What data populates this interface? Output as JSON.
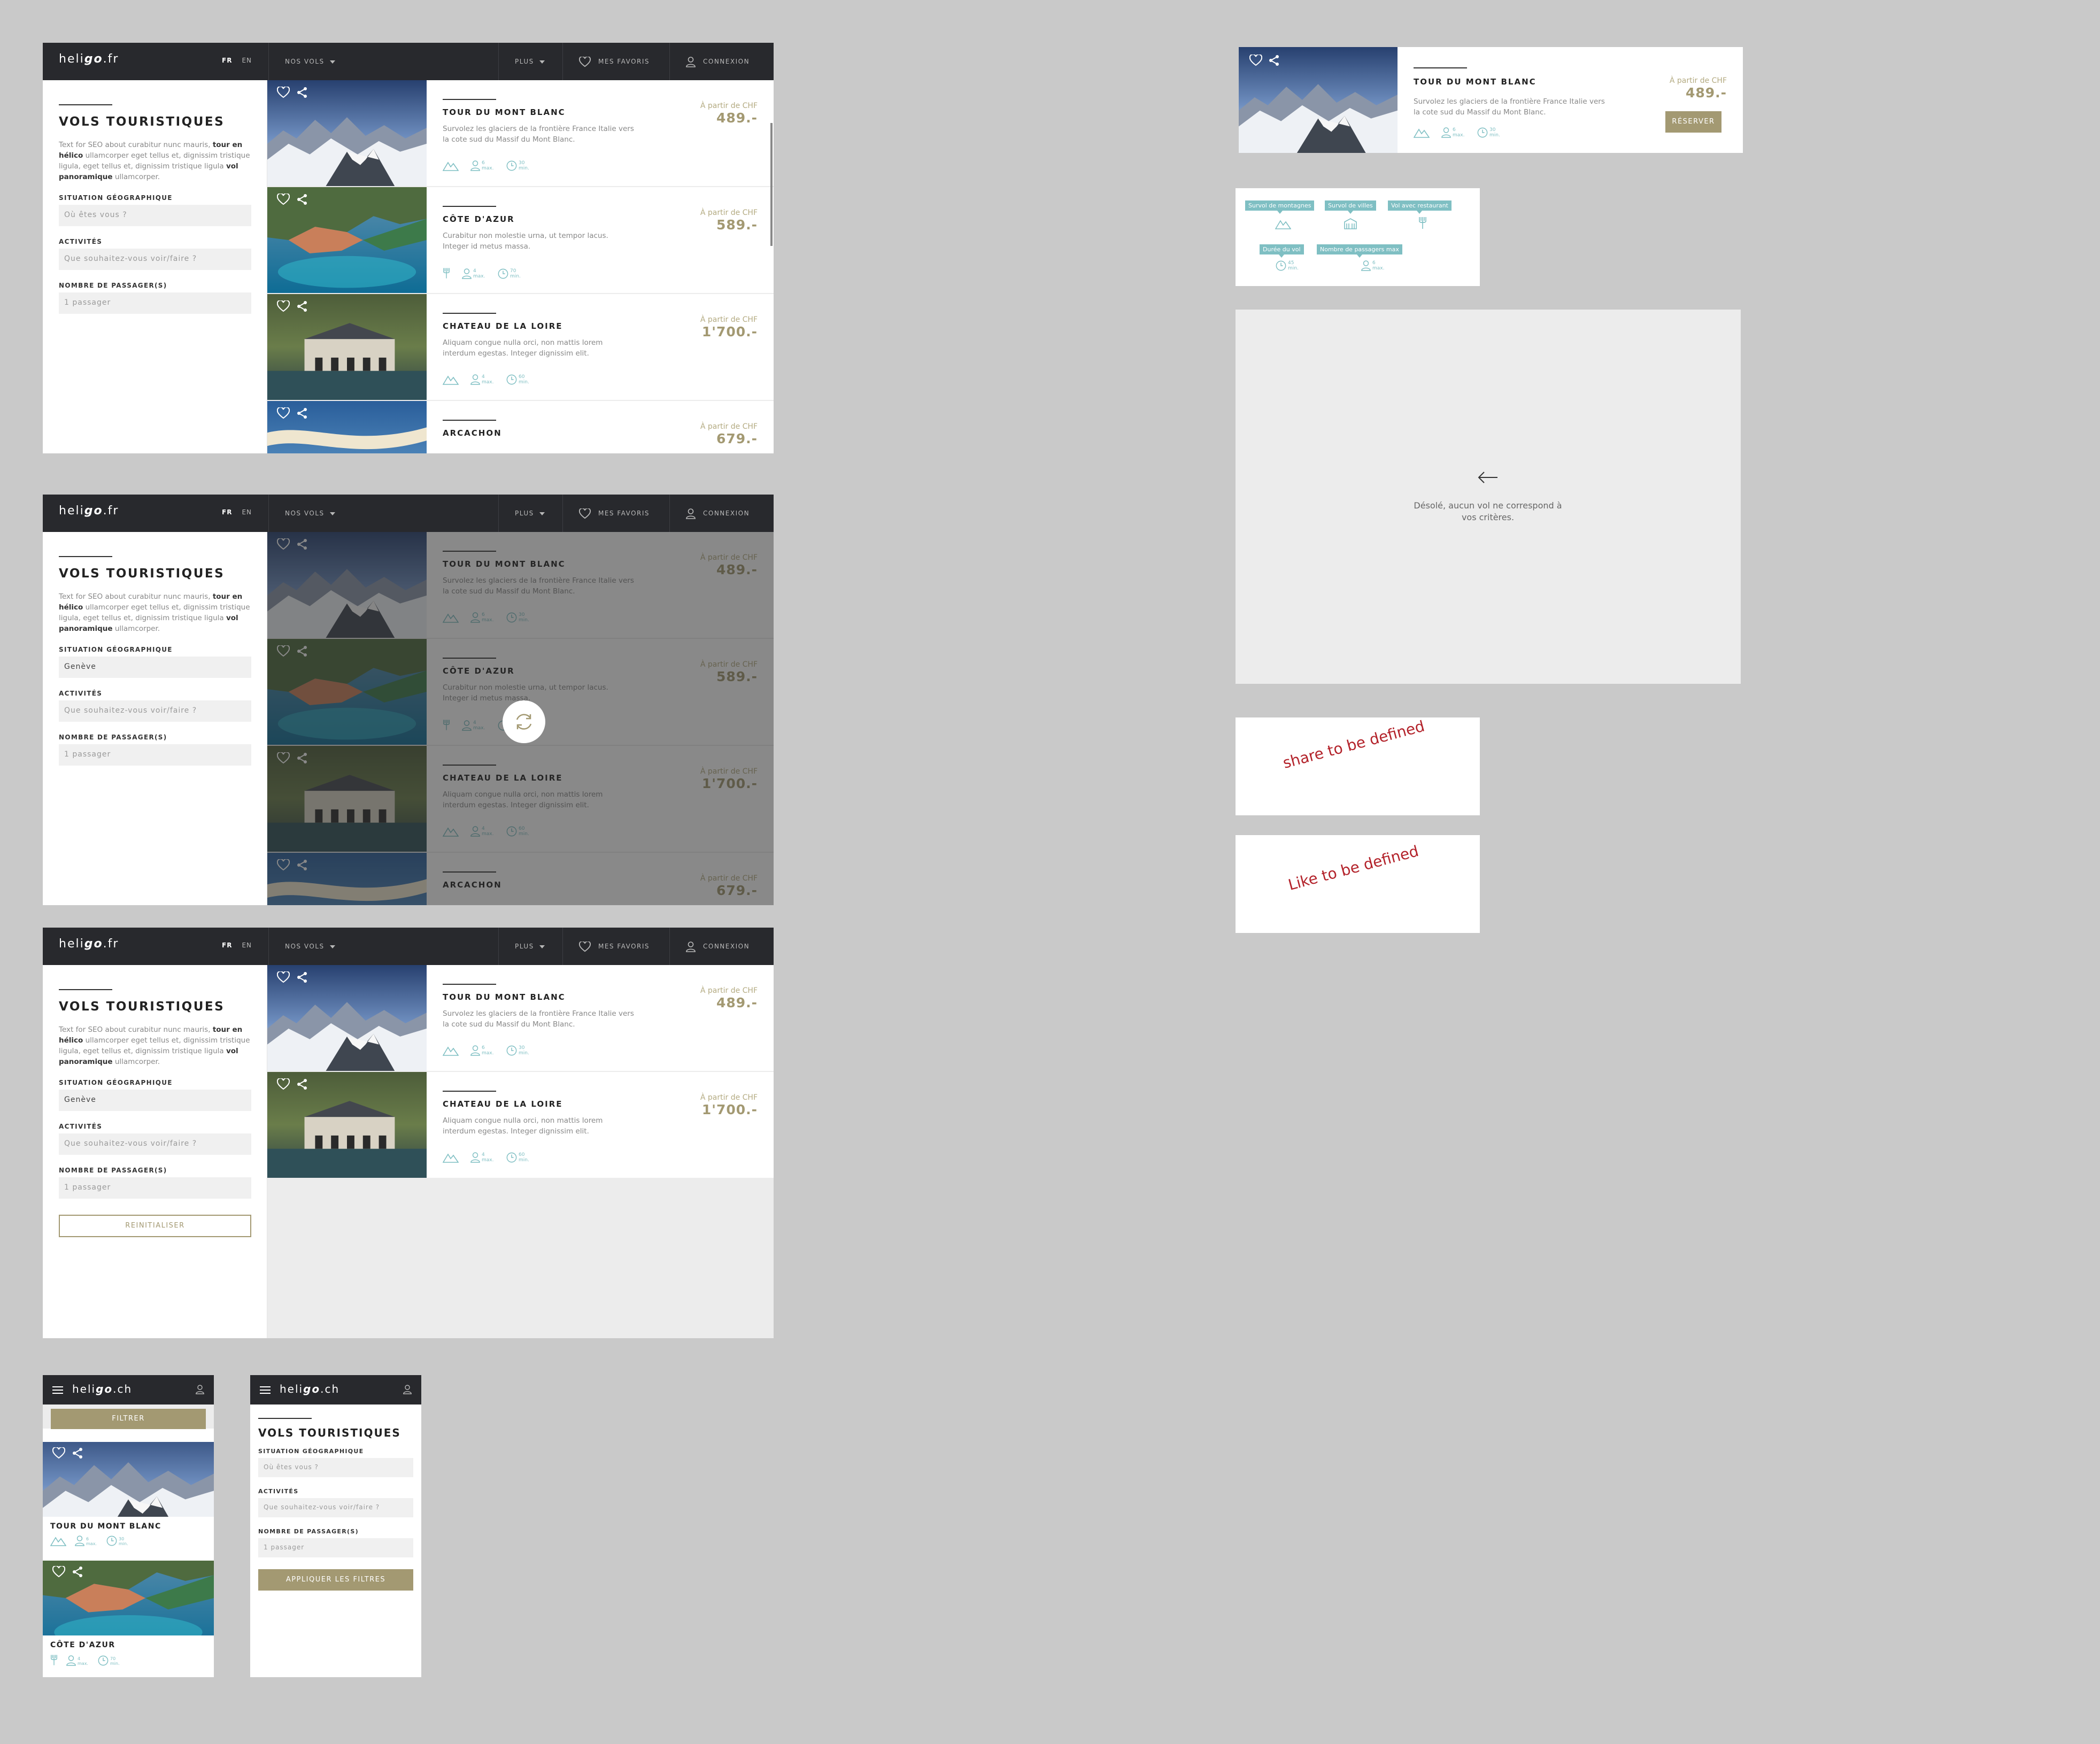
{
  "site": {
    "logo_a": "heli",
    "logo_b": "go",
    "logo_c": ".fr",
    "mobile_logo_c": ".ch"
  },
  "nav": {
    "lang_fr": "FR",
    "lang_en": "EN",
    "flights": "NOS VOLS",
    "more": "PLUS",
    "favorites": "MES FAVORIS",
    "login": "CONNEXION"
  },
  "sidebar": {
    "title": "VOLS TOURISTIQUES",
    "seo_1": "Text for SEO about curabitur nunc mauris, ",
    "seo_b1": "tour en hélico",
    "seo_2": " ullamcorper eget tellus et, dignissim tristique ligula, eget tellus et, dignissim tristique ligula ",
    "seo_b2": "vol panoramique",
    "seo_3": " ullamcorper.",
    "loc_label": "SITUATION GÉOGRAPHIQUE",
    "loc_placeholder": "Où êtes vous ?",
    "loc_value": "Genève",
    "act_label": "ACTIVITÉS",
    "act_placeholder": "Que souhaitez-vous voir/faire ?",
    "pax_label": "NOMBRE DE PASSAGER(S)",
    "pax_value": "1 passager",
    "reset": "REINITIALISER"
  },
  "price_from": "À partir de CHF",
  "cards": [
    {
      "title": "TOUR DU MONT BLANC",
      "desc": "Survolez les glaciers de la frontière France Italie vers la cote sud du Massif du Mont Blanc.",
      "price": "489.-",
      "pax": "6 max.",
      "dur": "30 min."
    },
    {
      "title": "CÔTE D'AZUR",
      "desc": "Curabitur non molestie urna, ut tempor lacus. Integer id metus massa.",
      "price": "589.-",
      "pax": "4 max.",
      "dur": "70 min."
    },
    {
      "title": "CHATEAU DE LA LOIRE",
      "desc": "Aliquam congue nulla orci, non mattis lorem interdum egestas. Integer dignissim elit.",
      "price": "1'700.-",
      "pax": "4 max.",
      "dur": "60 min."
    },
    {
      "title": "ARCACHON",
      "desc": "",
      "price": "679.-",
      "pax": "",
      "dur": ""
    }
  ],
  "loading_desc_2": "Curabitur non molestie urna, ut tempor lacus. Integer id metus massa.",
  "widget": {
    "title": "TOUR DU MONT BLANC",
    "desc": "Survolez les glaciers de la frontière France Italie vers la cote sud du Massif du Mont Blanc.",
    "price": "489.-",
    "book": "RÉSERVER",
    "pax": "6 max.",
    "dur": "30 min."
  },
  "legend": {
    "mountain": "Survol de montagnes",
    "city": "Survol de villes",
    "restaurant": "Vol avec restaurant",
    "duration": "Durée du vol",
    "passengers": "Nombre de passagers max",
    "dur_val": "45 min.",
    "pax_val": "6 max."
  },
  "empty": {
    "message": "Désolé, aucun vol ne correspond à vos critères."
  },
  "notes": {
    "share": "share to be defined",
    "like": "Like to be defined"
  },
  "mobile": {
    "filter": "FILTRER",
    "apply": "APPLIQUER LES FILTRES"
  },
  "colors": {
    "nav": "#28292d",
    "gold": "#a39972",
    "teal": "#7fbfc3",
    "note_red": "#b3222a"
  }
}
